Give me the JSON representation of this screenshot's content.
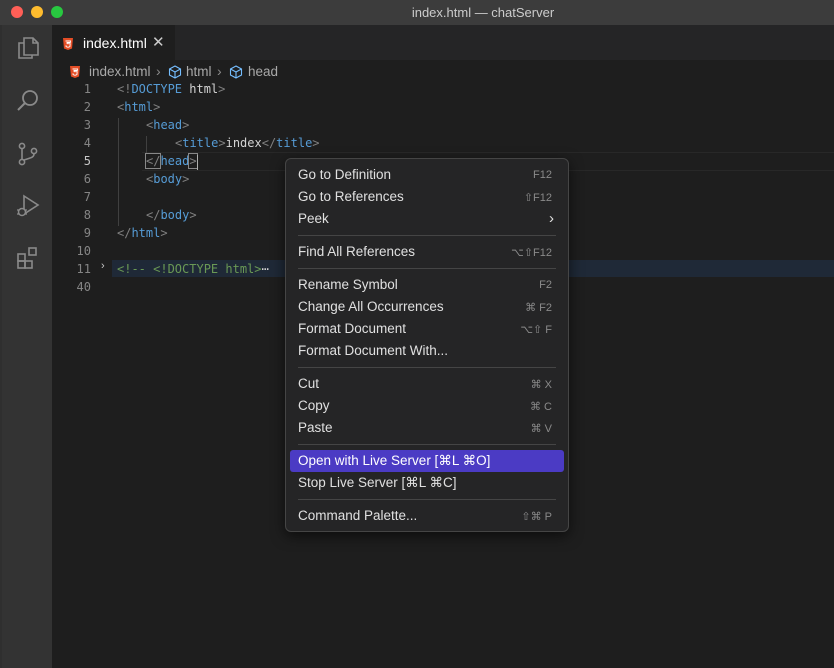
{
  "window": {
    "title": "index.html — chatServer"
  },
  "tab": {
    "label": "index.html",
    "close_glyph": "✕",
    "icon": "html5-icon",
    "icon_color": "#e44d26"
  },
  "breadcrumb": {
    "items": [
      "index.html",
      "html",
      "head"
    ],
    "separator": "›"
  },
  "activity_bar": {
    "icons": [
      "explorer-icon",
      "search-icon",
      "source-control-icon",
      "run-debug-icon",
      "extensions-icon"
    ]
  },
  "editor": {
    "line_numbers": [
      "1",
      "2",
      "3",
      "4",
      "5",
      "6",
      "7",
      "8",
      "9",
      "10",
      "11",
      "40"
    ],
    "active_line": "5",
    "lines": {
      "l1": {
        "open": "<!",
        "keyword": "DOCTYPE",
        "rest": " html",
        "close": ">"
      },
      "l2": {
        "open": "<",
        "tag": "html",
        "close": ">"
      },
      "l3": {
        "open": "<",
        "tag": "head",
        "close": ">"
      },
      "l4": {
        "open": "<",
        "tag": "title",
        "mid": ">",
        "text": "index",
        "open2": "</",
        "tag2": "title",
        "close": ">"
      },
      "l5": {
        "open": "</",
        "tag": "head",
        "close": ">"
      },
      "l6": {
        "open": "<",
        "tag": "body",
        "close": ">"
      },
      "l8": {
        "open": "</",
        "tag": "body",
        "close": ">"
      },
      "l9": {
        "open": "</",
        "tag": "html",
        "close": ">"
      },
      "l11": {
        "comment": "<!-- <!DOCTYPE html>",
        "ellipsis": "⋯"
      }
    },
    "fold_glyph": "›"
  },
  "context_menu": {
    "highlight_color": "#4b3bc4",
    "items": [
      {
        "label": "Go to Definition",
        "shortcut": "F12"
      },
      {
        "label": "Go to References",
        "shortcut": "⇧F12"
      },
      {
        "label": "Peek",
        "submenu": "›"
      },
      {
        "label": "Find All References",
        "shortcut": "⌥⇧F12"
      },
      {
        "label": "Rename Symbol",
        "shortcut": "F2"
      },
      {
        "label": "Change All Occurrences",
        "shortcut": "⌘ F2"
      },
      {
        "label": "Format Document",
        "shortcut": "⌥⇧ F"
      },
      {
        "label": "Format Document With..."
      },
      {
        "label": "Cut",
        "shortcut": "⌘ X"
      },
      {
        "label": "Copy",
        "shortcut": "⌘ C"
      },
      {
        "label": "Paste",
        "shortcut": "⌘ V"
      },
      {
        "label": "Open with Live Server [⌘L ⌘O]",
        "highlighted": true
      },
      {
        "label": "Stop Live Server [⌘L ⌘C]"
      },
      {
        "label": "Command Palette...",
        "shortcut": "⇧⌘ P"
      }
    ]
  }
}
